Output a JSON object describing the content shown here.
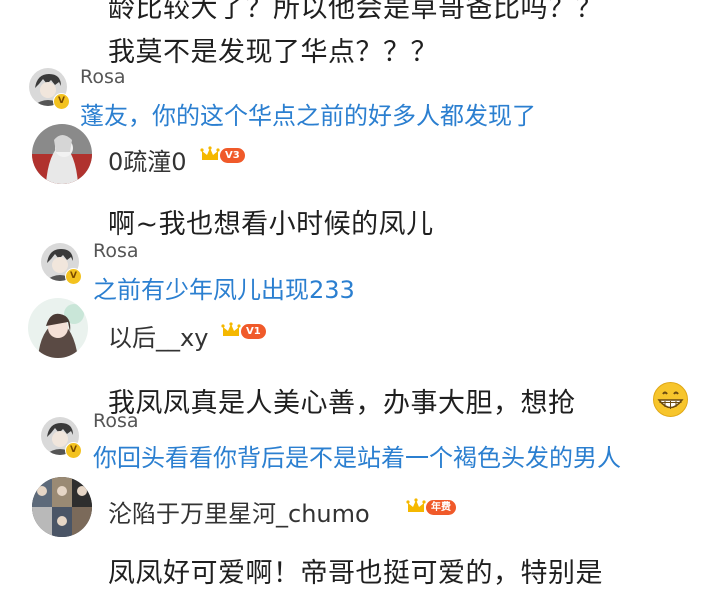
{
  "comments": [
    {
      "lines": [
        "龄比较大了？所以他会是草哥爸比吗？？",
        "我莫不是发现了华点？？？"
      ],
      "reply": {
        "user": "Rosa",
        "text": "蓬友，你的这个华点之前的好多人都发现了"
      }
    },
    {
      "user": "0疏潼0",
      "level": "V3",
      "text": "啊~我也想看小时候的凤儿",
      "reply": {
        "user": "Rosa",
        "text": "之前有少年凤儿出现233"
      }
    },
    {
      "user": "以后__xy",
      "level": "V1",
      "text": "我凤凤真是人美心善，办事大胆，想抢",
      "reply": {
        "user": "Rosa",
        "text": "你回头看看你背后是不是站着一个褐色头发的男人"
      }
    },
    {
      "user": "沦陷于万里星河_chumo",
      "level": "年费",
      "text": "凤凤好可爱啊！帝哥也挺可爱的，特别是"
    }
  ],
  "icons": {
    "verified": "verified-v-badge",
    "crown": "gold-crown-icon",
    "emoji": "grinning-face-emoji"
  },
  "colors": {
    "reply_text": "#2b7fd0",
    "level_badge": "#f05a2a",
    "crown": "#f5b800"
  }
}
